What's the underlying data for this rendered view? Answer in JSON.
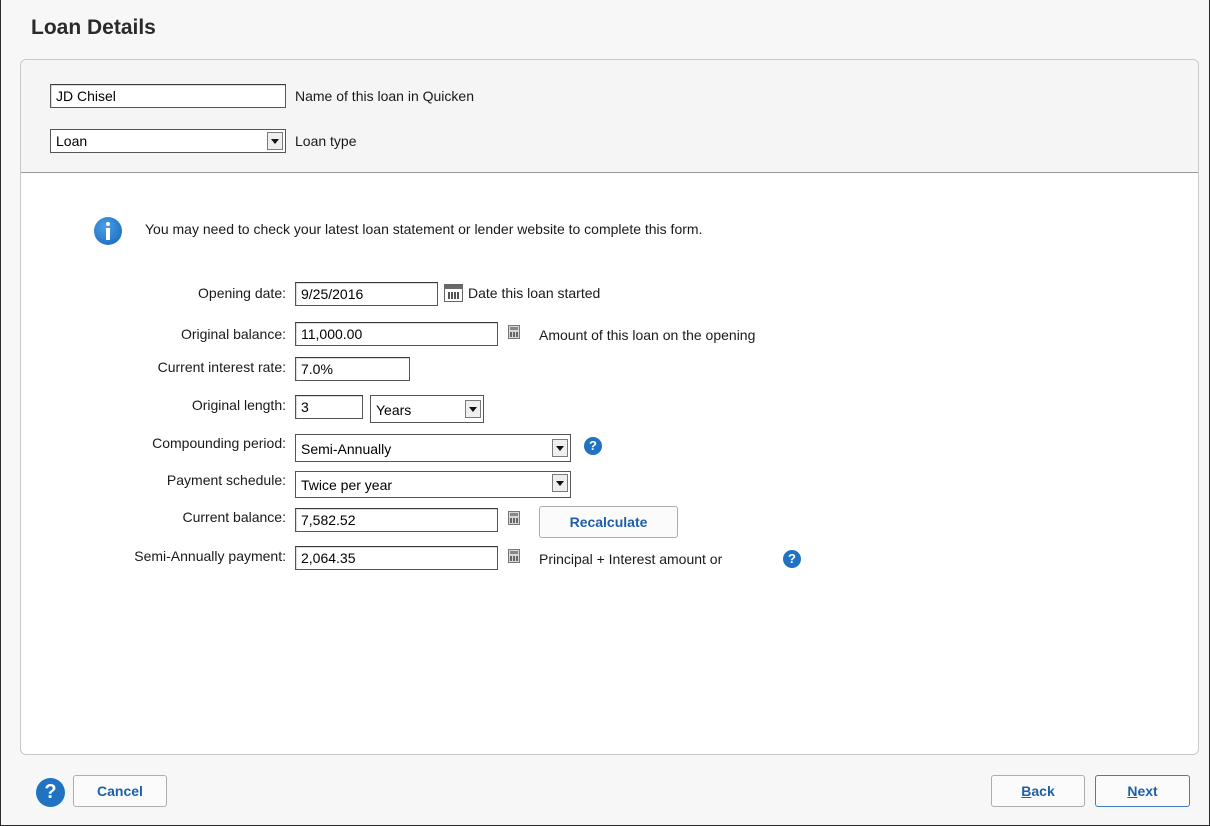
{
  "page": {
    "title": "Loan Details"
  },
  "loan_name": {
    "value": "JD Chisel",
    "label": "Name of this loan in Quicken"
  },
  "loan_type": {
    "value": "Loan",
    "label": "Loan type"
  },
  "info": {
    "icon": "info-icon",
    "text": "You may need to check your latest loan statement or lender website to complete this form."
  },
  "form": {
    "opening_date": {
      "label": "Opening date:",
      "value": "9/25/2016",
      "hint": "Date this loan started"
    },
    "original_balance": {
      "label": "Original balance:",
      "value": "11,000.00",
      "hint": "Amount of this loan on the opening"
    },
    "interest_rate": {
      "label": "Current interest rate:",
      "value": "7.0%"
    },
    "original_length": {
      "label": "Original length:",
      "value": "3",
      "unit": "Years"
    },
    "compounding": {
      "label": "Compounding period:",
      "value": "Semi-Annually"
    },
    "payment_schedule": {
      "label": "Payment schedule:",
      "value": "Twice per year"
    },
    "current_balance": {
      "label": "Current balance:",
      "value": "7,582.52",
      "button": "Recalculate"
    },
    "payment": {
      "label": "Semi-Annually payment:",
      "value": "2,064.35",
      "hint": "Principal + Interest amount or"
    }
  },
  "footer": {
    "cancel": "Cancel",
    "back_prefix": "B",
    "back_rest": "ack",
    "next_prefix": "N",
    "next_rest": "ext"
  },
  "colors": {
    "accent": "#1f73c2",
    "link": "#1f5fa8"
  }
}
